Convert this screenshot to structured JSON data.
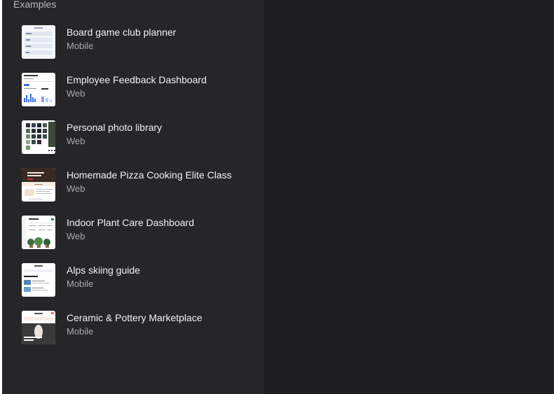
{
  "examples": {
    "section_title": "Examples",
    "items": [
      {
        "title": "Board game club planner",
        "platform": "Mobile",
        "thumbnail": "board-game-planner-thumbnail"
      },
      {
        "title": "Employee Feedback Dashboard",
        "platform": "Web",
        "thumbnail": "feedback-dashboard-thumbnail"
      },
      {
        "title": "Personal photo library",
        "platform": "Web",
        "thumbnail": "photo-library-thumbnail"
      },
      {
        "title": "Homemade Pizza Cooking Elite Class",
        "platform": "Web",
        "thumbnail": "pizza-class-thumbnail"
      },
      {
        "title": "Indoor Plant Care Dashboard",
        "platform": "Web",
        "thumbnail": "plant-care-thumbnail"
      },
      {
        "title": "Alps skiing guide",
        "platform": "Mobile",
        "thumbnail": "skiing-guide-thumbnail"
      },
      {
        "title": "Ceramic & Pottery Marketplace",
        "platform": "Mobile",
        "thumbnail": "pottery-marketplace-thumbnail"
      }
    ]
  },
  "colors": {
    "left_panel_bg": "#262628",
    "right_panel_bg": "#1f1f21",
    "title_text": "#f2f2f4",
    "subtitle_text": "#a9a9ad"
  }
}
